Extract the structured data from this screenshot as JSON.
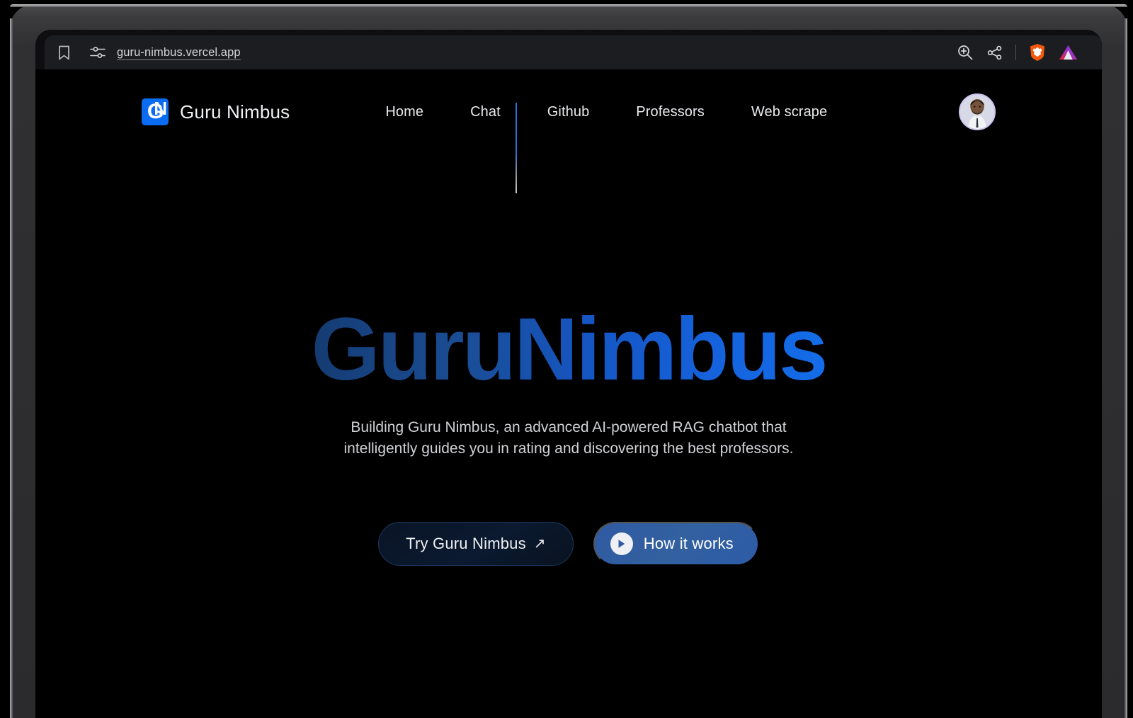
{
  "browser": {
    "url": "guru-nimbus.vercel.app",
    "bookmark_icon": "bookmark-icon",
    "site_settings_icon": "sliders-icon",
    "actions": [
      {
        "icon": "zoom-in-icon",
        "name": "zoom-in-button"
      },
      {
        "icon": "share-icon",
        "name": "share-button"
      },
      {
        "icon": "brave-shield-icon",
        "name": "brave-shields-button"
      },
      {
        "icon": "brave-leo-icon",
        "name": "brave-leo-button"
      }
    ]
  },
  "nav": {
    "brand": "Guru Nimbus",
    "logo_letter": "G",
    "logo_letter_back": "N",
    "links": [
      {
        "label": "Home"
      },
      {
        "label": "Chat"
      },
      {
        "label": "Github"
      },
      {
        "label": "Professors"
      },
      {
        "label": "Web scrape"
      }
    ],
    "avatar_alt": "user-avatar"
  },
  "hero": {
    "title": "GuruNimbus",
    "subtitle": "Building Guru Nimbus, an advanced AI-powered RAG chatbot that intelligently guides you in rating and discovering the best professors.",
    "primary_cta": "Try Guru Nimbus",
    "primary_cta_arrow": "↗",
    "secondary_cta": "How it works"
  },
  "colors": {
    "accent_blue": "#0a6cf1",
    "button_blue": "#2f5aa4",
    "title_gradient_start": "#0b1624",
    "title_gradient_end": "#0a72f7",
    "page_background": "#000000",
    "chrome_background": "#1c1d20"
  }
}
